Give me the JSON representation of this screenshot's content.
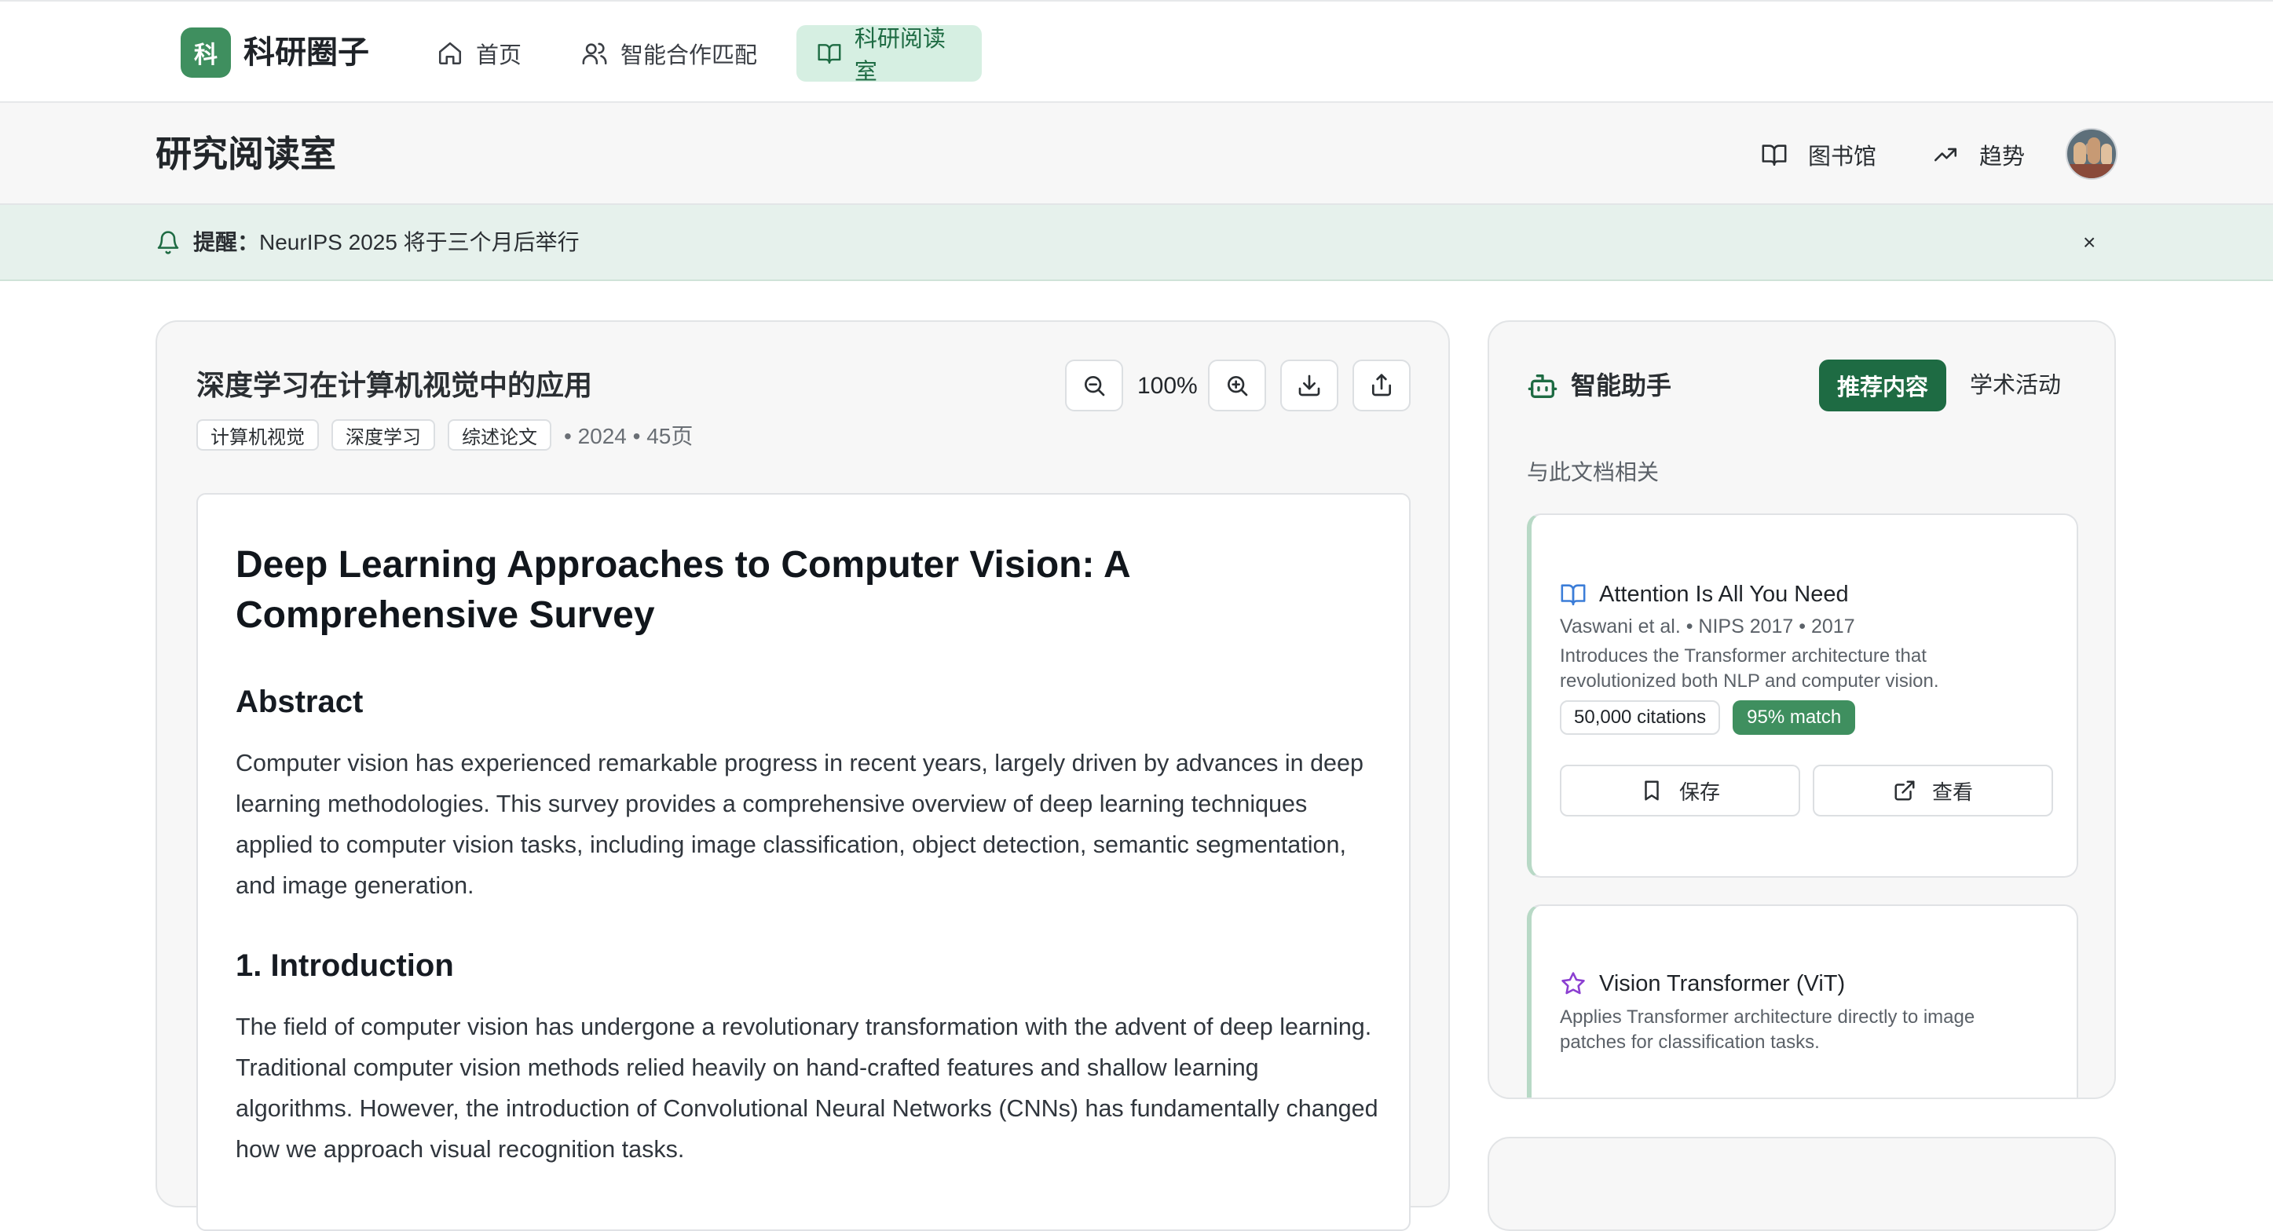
{
  "app": {
    "logo_char": "科",
    "name": "科研圈子",
    "nav": [
      {
        "label": "首页",
        "icon": "home-icon"
      },
      {
        "label": "智能合作匹配",
        "icon": "users-icon"
      },
      {
        "label": "科研阅读室",
        "icon": "book-open-icon",
        "active": true
      }
    ]
  },
  "subheader": {
    "title": "研究阅读室",
    "library_label": "图书馆",
    "trends_label": "趋势"
  },
  "notice": {
    "label": "提醒：",
    "text": "NeurIPS 2025 将于三个月后举行",
    "close": "×"
  },
  "document": {
    "title": "深度学习在计算机视觉中的应用",
    "tags": [
      "计算机视觉",
      "深度学习",
      "综述论文"
    ],
    "meta": "• 2024 • 45页",
    "zoom": "100%",
    "paper": {
      "title": "Deep Learning Approaches to Computer Vision: A Comprehensive Survey",
      "abstract_heading": "Abstract",
      "abstract": "Computer vision has experienced remarkable progress in recent years, largely driven by advances in deep learning methodologies. This survey provides a comprehensive overview of deep learning techniques applied to computer vision tasks, including image classification, object detection, semantic segmentation, and image generation.",
      "intro_heading": "1. Introduction",
      "intro": "The field of computer vision has undergone a revolutionary transformation with the advent of deep learning. Traditional computer vision methods relied heavily on hand-crafted features and shallow learning algorithms. However, the introduction of Convolutional Neural Networks (CNNs) has fundamentally changed how we approach visual recognition tasks."
    }
  },
  "assistant": {
    "title": "智能助手",
    "tab_recommend": "推荐内容",
    "tab_activities": "学术活动",
    "subtitle": "与此文档相关",
    "items": [
      {
        "icon": "book-icon",
        "icon_color": "#3b7dd8",
        "title": "Attention Is All You Need",
        "authors": "Vaswani et al. • NIPS 2017 • 2017",
        "desc": "Introduces the Transformer architecture that revolutionized both NLP and computer vision.",
        "citations": "50,000 citations",
        "match": "95% match",
        "save_label": "保存",
        "view_label": "查看"
      },
      {
        "icon": "star-icon",
        "icon_color": "#8b3fd1",
        "title": "Vision Transformer (ViT)",
        "desc": "Applies Transformer architecture directly to image patches for classification tasks."
      }
    ]
  },
  "colors": {
    "brand": "#3f8f5f",
    "brand_dark": "#1e6b43",
    "nav_active_bg": "#d6efe2",
    "notice_bg": "#e6f1ec"
  }
}
